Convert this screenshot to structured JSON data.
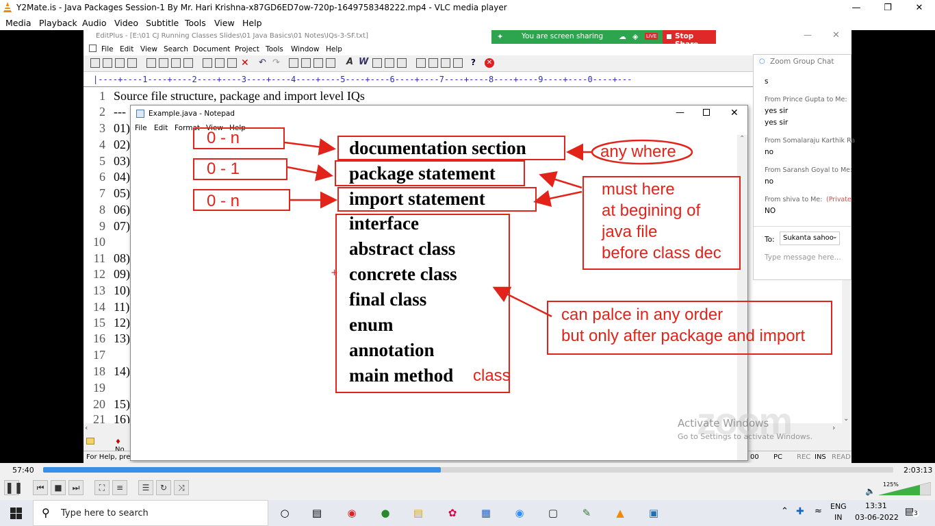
{
  "vlc": {
    "title": "Y2Mate.is - Java Packages Session-1  By Mr. Hari Krishna-x87GD6ED7ow-720p-1649758348222.mp4 - VLC media player",
    "menu": [
      "Media",
      "Playback",
      "Audio",
      "Video",
      "Subtitle",
      "Tools",
      "View",
      "Help"
    ],
    "time_elapsed": "57:40",
    "time_total": "2:03:13",
    "progress": 0.4677,
    "volume": "125%"
  },
  "editplus": {
    "title": "EditPlus - [E:\\01 CJ Running Classes Slides\\01 Java Basics\\01 Notes\\IQs-3-SF.txt]",
    "menu": [
      "File",
      "Edit",
      "View",
      "Search",
      "Document",
      "Project",
      "Tools",
      "Window",
      "Help"
    ],
    "ruler": "|----+----1----+----2----+----3----+----4----+----5----+----6----+----7----+----8----+----9----+----0----+---",
    "line_numbers": [
      "1",
      "2",
      "3",
      "4",
      "5",
      "6",
      "7",
      "8",
      "9",
      "10",
      "11",
      "12",
      "13",
      "14",
      "15",
      "16",
      "17",
      "18",
      "19",
      "20",
      "21"
    ],
    "line_contents": [
      "Source file structure, package and import level IQs",
      "---",
      "01)",
      "02)",
      "03)",
      "04)",
      "05)",
      "06)",
      "07)",
      "",
      "08)",
      "09)",
      "10)",
      "11)",
      "12)",
      "13)",
      "",
      "14)",
      "",
      "15)",
      "16)"
    ],
    "status_left": "For Help, pres",
    "status_right": [
      "00",
      "PC",
      "REC",
      "INS",
      "READ"
    ],
    "tab_label": "No"
  },
  "notepad": {
    "title": "Example.java - Notepad",
    "menu": [
      "File",
      "Edit",
      "Format",
      "View",
      "Help"
    ]
  },
  "annotations": {
    "left_boxes": [
      "0 - n",
      "0 - 1",
      "0 - n"
    ],
    "sections": [
      "documentation section",
      "package statement",
      "import statement"
    ],
    "list": [
      "interface",
      "abstract class",
      "concrete class",
      "final class",
      "enum",
      "annotation",
      "main method"
    ],
    "class_note": "class",
    "any_where": "any where",
    "must_here": [
      "must here",
      "at begining of",
      "java file",
      "before class dec"
    ],
    "order_note": [
      "can palce in any order",
      "but only after package and import"
    ]
  },
  "zoom": {
    "share_text": "You are screen sharing",
    "live": "LIVE",
    "stop_share": "Stop Share",
    "chat_title": "Zoom Group Chat",
    "messages": [
      {
        "from": "",
        "text": "s"
      },
      {
        "from": "From Prince Gupta to Me:",
        "text": "yes sir"
      },
      {
        "from": "",
        "text": "yes sir"
      },
      {
        "from": "From Somalaraju Karthik Ra",
        "text": "no"
      },
      {
        "from": "From Saransh Goyal to Me:",
        "text": "no"
      },
      {
        "from": "From shiva to Me:",
        "text": "NO",
        "private": "(Private"
      }
    ],
    "to_label": "To:",
    "to_value": "Sukanta sahoo",
    "input_placeholder": "Type message here...",
    "watermark_brand": "zoom",
    "activate": "Activate Windows",
    "activate_sub": "Go to Settings to activate Windows."
  },
  "taskbar": {
    "search_placeholder": "Type here to search",
    "lang_top": "ENG",
    "lang_bottom": "IN",
    "time": "13:31",
    "date": "03-06-2022",
    "notif_count": "3"
  },
  "colors": {
    "annotation_red": "#e2231a",
    "vlc_progress": "#3a8ee6",
    "zoom_green": "#2da44e",
    "zoom_red": "#e02828"
  }
}
